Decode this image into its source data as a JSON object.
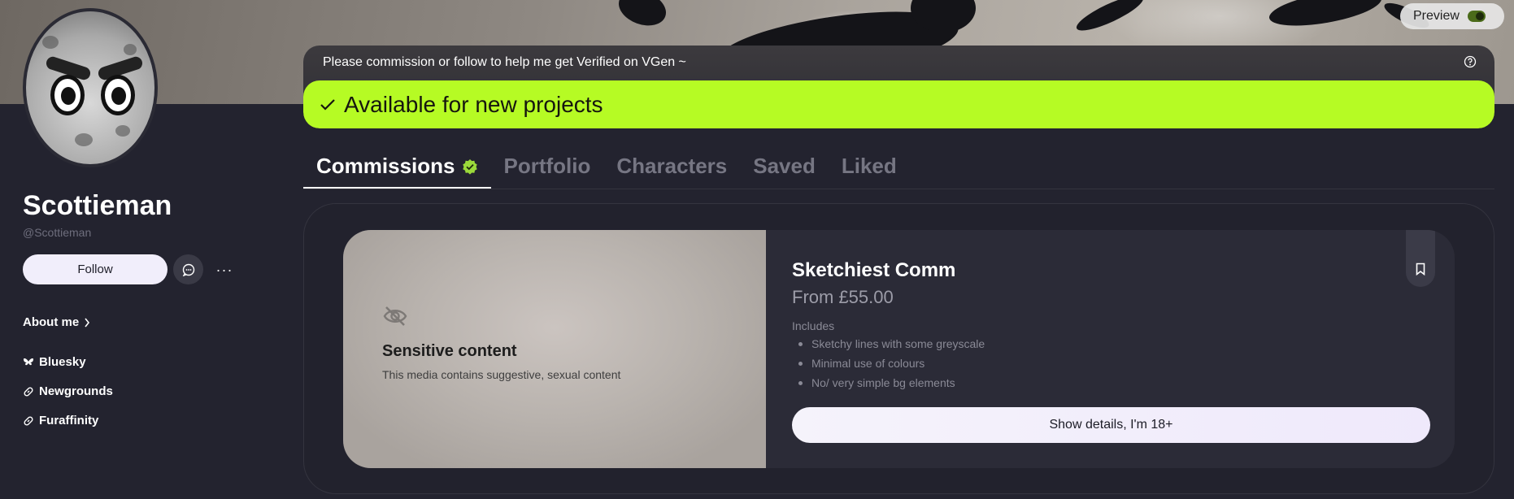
{
  "preview": {
    "label": "Preview",
    "enabled": true
  },
  "profile": {
    "name": "Scottieman",
    "handle": "@Scottieman",
    "follow_label": "Follow",
    "more_label": "···",
    "about_label": "About me",
    "links": [
      {
        "label": "Bluesky",
        "icon": "butterfly-icon"
      },
      {
        "label": "Newgrounds",
        "icon": "link-icon"
      },
      {
        "label": "Furaffinity",
        "icon": "link-icon"
      }
    ]
  },
  "notice": {
    "text": "Please commission or follow to help me get Verified on VGen ~",
    "status": "Available for new projects",
    "status_color": "#b6fb24"
  },
  "tabs": [
    {
      "label": "Commissions",
      "active": true,
      "verified": true
    },
    {
      "label": "Portfolio",
      "active": false
    },
    {
      "label": "Characters",
      "active": false
    },
    {
      "label": "Saved",
      "active": false
    },
    {
      "label": "Liked",
      "active": false
    }
  ],
  "commission": {
    "sensitive_title": "Sensitive content",
    "sensitive_desc": "This media contains suggestive, sexual content",
    "title": "Sketchiest Comm",
    "price": "From £55.00",
    "includes_label": "Includes",
    "includes": [
      "Sketchy lines with some greyscale",
      "Minimal use of colours",
      "No/ very simple bg elements"
    ],
    "cta": "Show details, I'm 18+"
  }
}
